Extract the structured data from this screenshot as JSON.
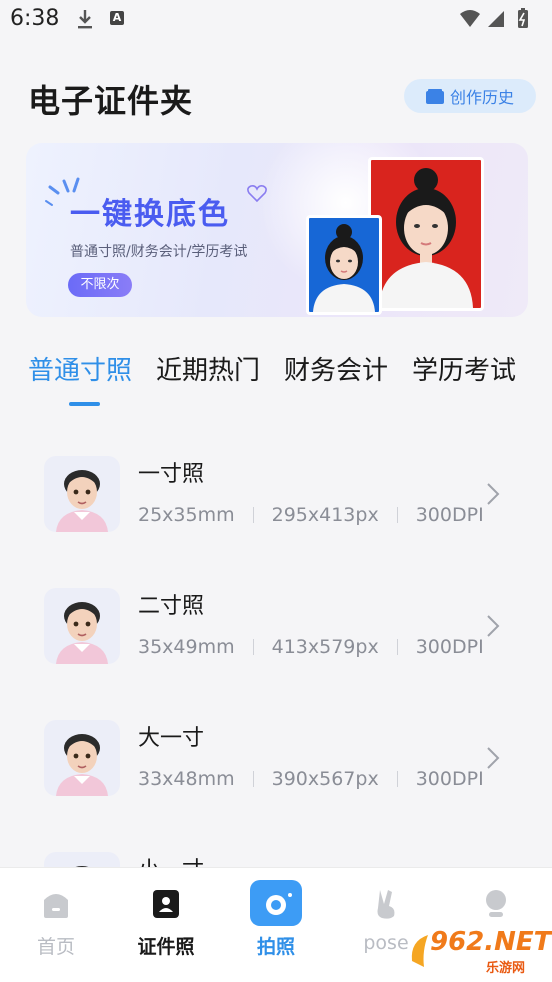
{
  "status_bar": {
    "time": "6:38",
    "notif_a": "A"
  },
  "header": {
    "title": "电子证件夹",
    "history_label": "创作历史"
  },
  "banner": {
    "title": "一键换底色",
    "subtitle": "普通寸照/财务会计/学历考试",
    "badge": "不限次"
  },
  "tabs": [
    {
      "label": "普通寸照",
      "active": true
    },
    {
      "label": "近期热门",
      "active": false
    },
    {
      "label": "财务会计",
      "active": false
    },
    {
      "label": "学历考试",
      "active": false
    }
  ],
  "photo_sizes": [
    {
      "name": "一寸照",
      "size": "25x35mm",
      "pixels": "295x413px",
      "dpi": "300DPI"
    },
    {
      "name": "二寸照",
      "size": "35x49mm",
      "pixels": "413x579px",
      "dpi": "300DPI"
    },
    {
      "name": "大一寸",
      "size": "33x48mm",
      "pixels": "390x567px",
      "dpi": "300DPI"
    },
    {
      "name": "小一寸"
    }
  ],
  "bottom_nav": [
    {
      "label": "首页",
      "icon": "home-icon"
    },
    {
      "label": "证件照",
      "icon": "id-card-icon"
    },
    {
      "label": "拍照",
      "icon": "camera-icon"
    },
    {
      "label": "pose",
      "icon": "victory-hand-icon"
    },
    {
      "label": "",
      "icon": "profile-icon"
    }
  ],
  "watermark": {
    "text": "962.NET",
    "sub": "乐游网"
  },
  "colors": {
    "accent": "#2f8fe8",
    "banner_title": "#4a5cf0",
    "red_bg": "#d9241e",
    "blue_bg": "#1767d6"
  }
}
